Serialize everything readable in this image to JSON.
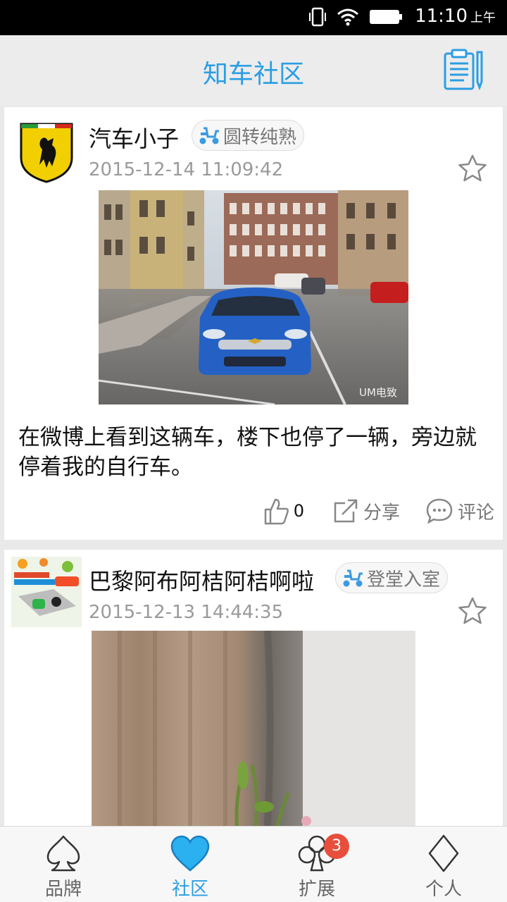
{
  "status_bar": {
    "time": "11:10",
    "ampm": "上午"
  },
  "header": {
    "title": "知车社区"
  },
  "posts": [
    {
      "username": "汽车小子",
      "badge": "圆转纯熟",
      "timestamp": "2015-12-14 11:09:42",
      "watermark": "UM电致",
      "text": "在微博上看到这辆车，楼下也停了一辆，旁边就停着我的自行车。",
      "likes": "0",
      "share_label": "分享",
      "comment_label": "评论"
    },
    {
      "username": "巴黎阿布阿桔阿桔啊啦",
      "badge": "登堂入室",
      "timestamp": "2015-12-13 14:44:35"
    }
  ],
  "bottom_nav": [
    {
      "label": "品牌",
      "icon": "spade-icon"
    },
    {
      "label": "社区",
      "icon": "heart-icon",
      "active": true
    },
    {
      "label": "扩展",
      "icon": "club-icon",
      "badge": "3"
    },
    {
      "label": "个人",
      "icon": "diamond-icon"
    }
  ],
  "colors": {
    "accent": "#2b9ee3",
    "badge_red": "#e84e3c"
  }
}
